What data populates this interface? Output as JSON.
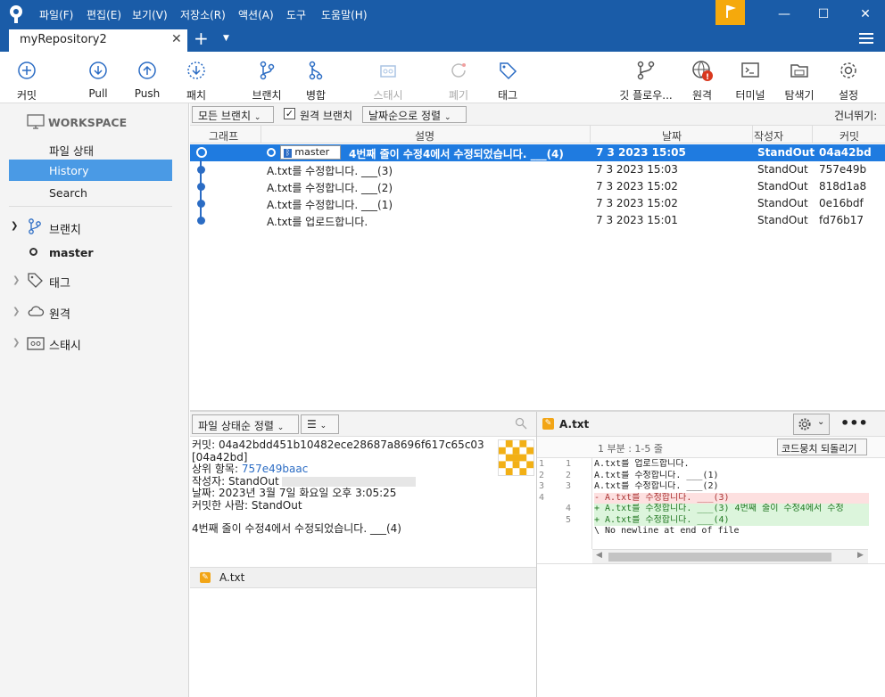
{
  "menu": [
    "파일(F)",
    "편집(E)",
    "보기(V)",
    "저장소(R)",
    "액션(A)",
    "도구",
    "도움말(H)"
  ],
  "tab": {
    "title": "myRepository2"
  },
  "toolbar": {
    "commit": "커밋",
    "pull": "Pull",
    "push": "Push",
    "patch": "패치",
    "branch": "브랜치",
    "merge": "병합",
    "stash": "스태시",
    "discard": "폐기",
    "tag": "태그",
    "gitflow": "깃 플로우...",
    "remote": "원격",
    "terminal": "터미널",
    "explorer": "탐색기",
    "settings": "설정"
  },
  "sidebar": {
    "workspace": "WORKSPACE",
    "file_status": "파일 상태",
    "history": "History",
    "search": "Search",
    "branches": "브랜치",
    "master": "master",
    "tags": "태그",
    "remotes": "원격",
    "stashes": "스태시"
  },
  "filters": {
    "all_branches": "모든 브랜치",
    "remote_branches": "원격 브랜치",
    "sort": "날짜순으로 정렬",
    "jump": "건너뛰기:"
  },
  "columns": {
    "graph": "그래프",
    "description": "설명",
    "date": "날짜",
    "author": "작성자",
    "commit": "커밋"
  },
  "commits": [
    {
      "branch": "master",
      "desc": "4번째 줄이 수정4에서 수정되었습니다. ___(4)",
      "date": "7 3 2023 15:05",
      "author": "StandOut",
      "hash": "04a42bd"
    },
    {
      "desc": "A.txt를 수정합니다. ___(3)",
      "date": "7 3 2023 15:03",
      "author": "StandOut",
      "hash": "757e49b"
    },
    {
      "desc": "A.txt를 수정합니다. ___(2)",
      "date": "7 3 2023 15:02",
      "author": "StandOut",
      "hash": "818d1a8"
    },
    {
      "desc": "A.txt를 수정합니다. ___(1)",
      "date": "7 3 2023 15:02",
      "author": "StandOut",
      "hash": "0e16bdf"
    },
    {
      "desc": "A.txt를 업로드합니다.",
      "date": "7 3 2023 15:01",
      "author": "StandOut",
      "hash": "fd76b17"
    }
  ],
  "lower": {
    "sort": "파일 상태순 정렬"
  },
  "details": {
    "commit_label": "커밋:",
    "commit_full": "04a42bdd451b10482ece28687a8696f617c65c03",
    "commit_short": "[04a42bd]",
    "parent_label": "상위 항목:",
    "parent": "757e49baac",
    "author_label": "작성자:",
    "author": "StandOut",
    "date_label": "날짜:",
    "date": "2023년 3월 7일 화요일 오후 3:05:25",
    "committer_label": "커밋한 사람:",
    "committer": "StandOut",
    "message": "4번째 줄이 수정4에서 수정되었습니다. ___(4)"
  },
  "file": {
    "name": "A.txt"
  },
  "diff": {
    "hunk": "1 부분 : 1-5 줄",
    "revert": "코드뭉치 되돌리기",
    "lines": [
      {
        "n1": "1",
        "n2": "1",
        "t": "  A.txt를 업로드합니다.",
        "k": ""
      },
      {
        "n1": "2",
        "n2": "2",
        "t": "  A.txt를 수정합니다. ___(1)",
        "k": ""
      },
      {
        "n1": "3",
        "n2": "3",
        "t": "  A.txt를 수정합니다. ___(2)",
        "k": ""
      },
      {
        "n1": "4",
        "n2": "",
        "t": "- A.txt를 수정합니다. ___(3)",
        "k": "del"
      },
      {
        "n1": "",
        "n2": "4",
        "t": "+ A.txt를 수정합니다. ___(3) 4번째 줄이 수정4에서 수정",
        "k": "add"
      },
      {
        "n1": "",
        "n2": "5",
        "t": "+ A.txt를 수정합니다. ___(4)",
        "k": "add"
      },
      {
        "n1": "",
        "n2": "",
        "t": " \\  No newline at end of file",
        "k": ""
      }
    ]
  },
  "colors": {
    "titlebar": "#1a5ca8",
    "selection": "#1f7be0",
    "accent": "#f5a90c"
  }
}
